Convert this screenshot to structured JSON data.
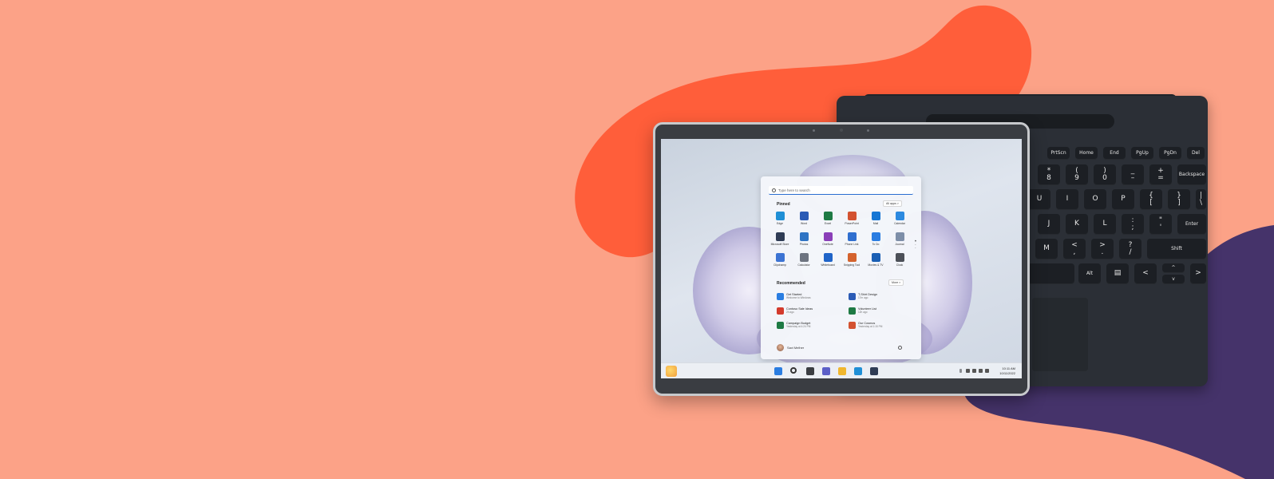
{
  "colors": {
    "background": "#FCA287",
    "accent_blob": "#FF5E3A",
    "dark_blob": "#45336A",
    "keyboard": "#2B2F36"
  },
  "keyboard": {
    "keys": [
      {
        "id": "k-prtsc",
        "label": "PrtScn"
      },
      {
        "id": "k-home",
        "label": "Home"
      },
      {
        "id": "k-end",
        "label": "End"
      },
      {
        "id": "k-pgup",
        "label": "PgUp"
      },
      {
        "id": "k-pgdn",
        "label": "PgDn"
      },
      {
        "id": "k-del",
        "label": "Del"
      },
      {
        "id": "k-8",
        "label": "*\n8"
      },
      {
        "id": "k-9",
        "label": "(\n9"
      },
      {
        "id": "k-0",
        "label": ")\n0"
      },
      {
        "id": "k-minus",
        "label": "_\n–"
      },
      {
        "id": "k-plus",
        "label": "+\n="
      },
      {
        "id": "k-backspace",
        "label": "Backspace"
      },
      {
        "id": "k-u",
        "label": "U"
      },
      {
        "id": "k-i",
        "label": "I"
      },
      {
        "id": "k-o",
        "label": "O"
      },
      {
        "id": "k-p",
        "label": "P"
      },
      {
        "id": "k-lbr",
        "label": "{\n["
      },
      {
        "id": "k-rbr",
        "label": "}\n]"
      },
      {
        "id": "k-bs",
        "label": "|\n\\"
      },
      {
        "id": "k-j",
        "label": "J"
      },
      {
        "id": "k-k",
        "label": "K"
      },
      {
        "id": "k-l",
        "label": "L"
      },
      {
        "id": "k-semi",
        "label": ":\n;"
      },
      {
        "id": "k-quote",
        "label": "\"\n'"
      },
      {
        "id": "k-enter",
        "label": "Enter"
      },
      {
        "id": "k-m",
        "label": "M"
      },
      {
        "id": "k-comma",
        "label": "<\n,"
      },
      {
        "id": "k-period",
        "label": ">\n."
      },
      {
        "id": "k-slash",
        "label": "?\n/"
      },
      {
        "id": "k-shift",
        "label": "Shift"
      },
      {
        "id": "k-space",
        "label": ""
      },
      {
        "id": "k-alt",
        "label": "Alt"
      },
      {
        "id": "k-menu",
        "label": "▤"
      },
      {
        "id": "k-left",
        "label": "<"
      },
      {
        "id": "k-up",
        "label": "^"
      },
      {
        "id": "k-down",
        "label": "v"
      },
      {
        "id": "k-right",
        "label": ">"
      }
    ]
  },
  "start_menu": {
    "search_placeholder": "Type here to search",
    "pinned_title": "Pinned",
    "all_apps_label": "All apps  >",
    "pinned_apps": [
      {
        "label": "Edge",
        "color": "#1f8fd6"
      },
      {
        "label": "Word",
        "color": "#2b5bb5"
      },
      {
        "label": "Excel",
        "color": "#1e7a44"
      },
      {
        "label": "PowerPoint",
        "color": "#d35230"
      },
      {
        "label": "Mail",
        "color": "#1776d4"
      },
      {
        "label": "Calendar",
        "color": "#2d8ae0"
      },
      {
        "label": "Microsoft Store",
        "color": "#2f3c55"
      },
      {
        "label": "Photos",
        "color": "#2f74c4"
      },
      {
        "label": "OneNote",
        "color": "#8a3fb8"
      },
      {
        "label": "Phone Link",
        "color": "#2f6fcf"
      },
      {
        "label": "To Do",
        "color": "#2a7de1"
      },
      {
        "label": "Journal",
        "color": "#7d8ea8"
      },
      {
        "label": "Clipchamp",
        "color": "#3c73d3"
      },
      {
        "label": "Calculator",
        "color": "#6d7480"
      },
      {
        "label": "Whiteboard",
        "color": "#1f64c8"
      },
      {
        "label": "Snipping Tool",
        "color": "#d4632d"
      },
      {
        "label": "Movies & TV",
        "color": "#1a5fb4"
      },
      {
        "label": "Clock",
        "color": "#4c5058"
      }
    ],
    "recommended_title": "Recommended",
    "more_label": "More  >",
    "recommended": [
      {
        "name": "Get Started",
        "sub": "Welcome to Windows",
        "color": "#2a7de1"
      },
      {
        "name": "T-Shirt Design",
        "sub": "17m ago",
        "color": "#2b5bb5"
      },
      {
        "name": "Contoso Sale Ideas",
        "sub": "2h ago",
        "color": "#d33a2c"
      },
      {
        "name": "Volunteer List",
        "sub": "12h ago",
        "color": "#1e7a44"
      },
      {
        "name": "Campaign Budget",
        "sub": "Yesterday at 4:24 PM",
        "color": "#1e7a44"
      },
      {
        "name": "Our Cosmos",
        "sub": "Yesterday at 1:15 PM",
        "color": "#d35230"
      }
    ],
    "user_name": "Savi Melher"
  },
  "taskbar": {
    "icons": [
      {
        "name": "start-icon",
        "color": "#2a7de1"
      },
      {
        "name": "search-icon",
        "color": "#333333"
      },
      {
        "name": "task-view-icon",
        "color": "#3a3d42"
      },
      {
        "name": "chat-icon",
        "color": "#5b5fc7"
      },
      {
        "name": "file-explorer-icon",
        "color": "#f0b72f"
      },
      {
        "name": "edge-icon",
        "color": "#1f8fd6"
      },
      {
        "name": "store-icon",
        "color": "#2f3c55"
      }
    ],
    "time": "10:11 AM",
    "date": "10/11/2022"
  }
}
